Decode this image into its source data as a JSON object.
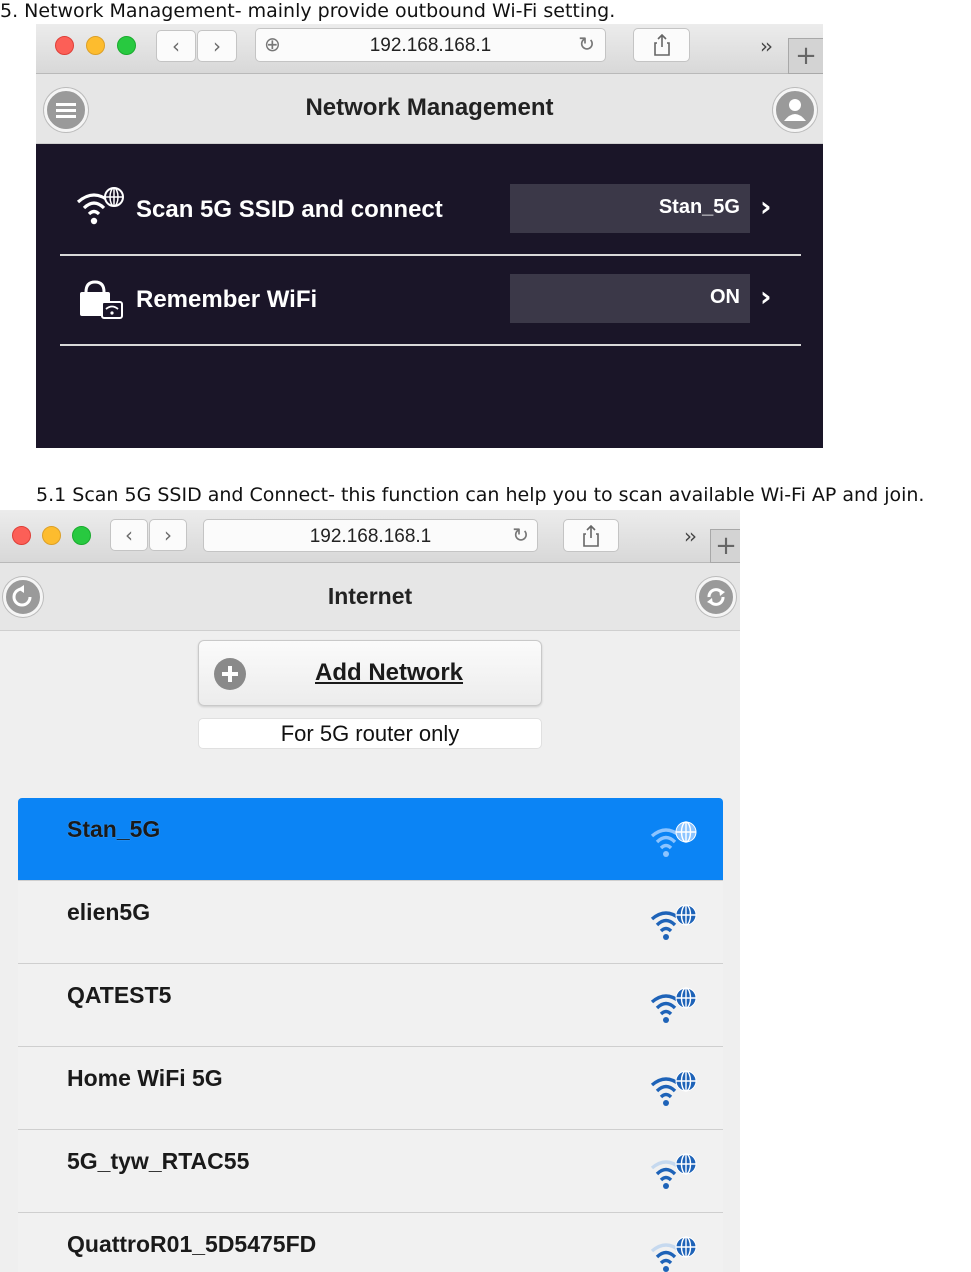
{
  "section5": {
    "heading": "5.   Network Management- mainly provide outbound Wi-Fi setting."
  },
  "browser1": {
    "url": "192.168.168.1"
  },
  "network_management": {
    "title": "Network Management",
    "rows": [
      {
        "label": "Scan 5G SSID and connect",
        "value": "Stan_5G",
        "icon": "wifi-globe-icon"
      },
      {
        "label": "Remember WiFi",
        "value": "ON",
        "icon": "lock-wifi-icon"
      }
    ]
  },
  "section51": {
    "heading": "5.1 Scan 5G SSID and Connect- this function can help you to scan available Wi-Fi AP and join."
  },
  "browser2": {
    "url": "192.168.168.1"
  },
  "internet": {
    "title": "Internet",
    "add_network_label": "Add Network",
    "note": "For 5G router only",
    "networks": [
      {
        "name": "Stan_5G",
        "selected": true,
        "signal": "weak"
      },
      {
        "name": "elien5G",
        "selected": false,
        "signal": "strong"
      },
      {
        "name": "QATEST5",
        "selected": false,
        "signal": "strong"
      },
      {
        "name": "Home WiFi 5G",
        "selected": false,
        "signal": "strong"
      },
      {
        "name": "5G_tyw_RTAC55",
        "selected": false,
        "signal": "weak"
      },
      {
        "name": "QuattroR01_5D5475FD",
        "selected": false,
        "signal": "weak"
      }
    ]
  },
  "colors": {
    "accent": "#0b84f5",
    "panel": "#1a1528",
    "value_box": "#3b3848",
    "wifi_blue": "#1e63b8"
  }
}
